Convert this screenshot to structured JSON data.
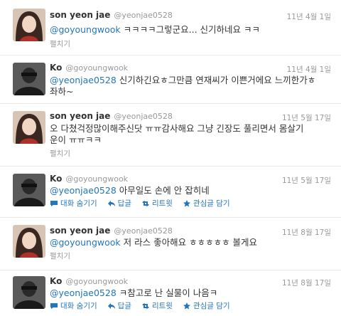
{
  "tweets": [
    {
      "name": "son yeon jae",
      "handle": "@yeonjae0528",
      "date": "11년 4월 1일",
      "mention": "@goyoungwook",
      "text": " ㅋㅋㅋㅋ그렇군요... 신기하네요 ㅋㅋ",
      "text2": "",
      "action": "펼치기"
    },
    {
      "name": "Ko",
      "handle": "@goyoungwook",
      "date": "11년 4월 1일",
      "mention": "@yeonjae0528",
      "text": " 신기하긴요ㅎ그만큼 연재씨가 이쁜거에요 느끼한가ㅎ",
      "text2": "좌하~",
      "action": ""
    },
    {
      "name": "son yeon jae",
      "handle": "@yeonjae0528",
      "date": "11년 5월 17일",
      "mention": "",
      "text": "오 다쳤걱정많이해주신닷 ㅠㅠ감사해요 그냥 긴장도 풀리면서 몸살기",
      "text2": "운이 ㅠㅠㅋㅋ",
      "action": "펼치기"
    },
    {
      "name": "Ko",
      "handle": "@goyoungwook",
      "date": "11년 5월 17일",
      "mention": "@yeonjae0528",
      "text": " 아무일도 손에 안 잡히네",
      "text2": "",
      "action": ""
    },
    {
      "name": "son yeon jae",
      "handle": "@yeonjae0528",
      "date": "11년 8월 17일",
      "mention": "@goyoungwook",
      "text": " 저 라스 좋아해요 ㅎㅎㅎㅎㅎ 볼게요",
      "text2": "",
      "action": "펼치기"
    },
    {
      "name": "Ko",
      "handle": "@goyoungwook",
      "date": "11년 8월 17일",
      "mention": "@yeonjae0528",
      "text": " ㅋ참고로 난 실물이 나음ㅋ",
      "text2": "",
      "action": ""
    }
  ],
  "actions": {
    "hide_conversation": "대화 숨기기",
    "reply": "답글",
    "retweet": "리트윗",
    "favorite": "관심글 담기"
  },
  "colors": {
    "link": "#2276bb",
    "muted": "#999999"
  }
}
